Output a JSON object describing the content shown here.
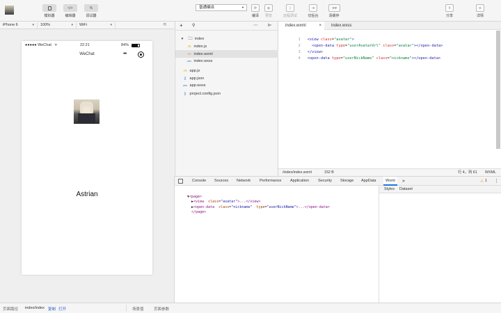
{
  "toolbar": {
    "simulator_label": "模拟器",
    "editor_label": "编辑器",
    "debugger_label": "调试器",
    "editor_glyph": "</>",
    "debugger_glyph": "%",
    "compile_mode": "普通编译",
    "compile_label": "编译",
    "preview_label": "预览",
    "remote_debug_label": "远程调试",
    "backend_label": "切后台",
    "clear_cache_label": "清缓存",
    "share_label": "分享",
    "details_label": "详情"
  },
  "device_bar": {
    "device": "iPhone 6",
    "zoom": "100%",
    "network": "WiFi"
  },
  "phone": {
    "carrier": "●●●●● WeChat",
    "time": "22:21",
    "battery": "84%",
    "nav_title": "WeChat",
    "nickname": "Astrian"
  },
  "file_tree": {
    "items": [
      {
        "name": "index",
        "type": "folder"
      },
      {
        "name": "index.js",
        "type": "js"
      },
      {
        "name": "index.wxml",
        "type": "wxml"
      },
      {
        "name": "index.wxss",
        "type": "wxss"
      },
      {
        "name": "app.js",
        "type": "js"
      },
      {
        "name": "app.json",
        "type": "json"
      },
      {
        "name": "app.wxss",
        "type": "wxss"
      },
      {
        "name": "project.config.json",
        "type": "json"
      }
    ]
  },
  "editor": {
    "tabs": [
      {
        "label": "index.wxml",
        "active": true
      },
      {
        "label": "index.wxss",
        "active": false
      }
    ],
    "line_numbers": [
      "1",
      "2",
      "3",
      "4"
    ],
    "code": {
      "l1": {
        "open": "<view",
        "attr": "class",
        "val": "\"avatar\"",
        "close": ">"
      },
      "l2": {
        "open": "<open-data",
        "attr1": "type",
        "val1": "\"userAvatarUrl\"",
        "attr2": "class",
        "val2": "\"avatar\"",
        "close": "></open-data>"
      },
      "l3": {
        "tag": "</view>"
      },
      "l4": {
        "open": "<open-data",
        "attr1": "type",
        "val1": "\"userNickName\"",
        "attr2": "class",
        "val2": "\"nickname\"",
        "close": "></open-data>"
      }
    },
    "status_path": "/index/index.wxml",
    "status_size": "152 B",
    "status_pos": "行 4，列 61",
    "status_lang": "WXML"
  },
  "devtools": {
    "tabs": [
      "Console",
      "Sources",
      "Network",
      "Performance",
      "Application",
      "Security",
      "Storage",
      "AppData",
      "Wxml"
    ],
    "active_tab": "Wxml",
    "more": "»",
    "warning_count": "1",
    "dom": {
      "page_open": "<page>",
      "line1": {
        "tag": "<view",
        "attr": "class",
        "val": "\"avatar\"",
        "rest": ">...</view>"
      },
      "line2": {
        "tag": "<open-data",
        "attr1": "class",
        "val1": "\"nickname\"",
        "attr2": "type",
        "val2": "\"userNickName\"",
        "rest": ">...</open-data>"
      },
      "page_close": "</page>"
    },
    "right_tabs": [
      "Styles",
      "Dataset"
    ]
  },
  "bottom": {
    "path_label": "页面路径",
    "path_value": "index/index",
    "copy": "复制",
    "open": "打开",
    "scene_label": "场景值",
    "params_label": "页面参数"
  },
  "colors": {
    "accent": "#1a73e8",
    "warning": "#f0a020"
  }
}
